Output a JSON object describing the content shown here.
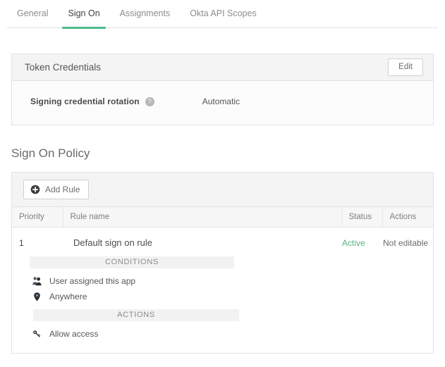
{
  "tabs": [
    {
      "label": "General",
      "active": false
    },
    {
      "label": "Sign On",
      "active": true
    },
    {
      "label": "Assignments",
      "active": false
    },
    {
      "label": "Okta API Scopes",
      "active": false
    }
  ],
  "token_credentials": {
    "title": "Token Credentials",
    "edit_label": "Edit",
    "help_glyph": "?",
    "field_label": "Signing credential rotation",
    "field_value": "Automatic"
  },
  "sign_on_policy": {
    "heading": "Sign On Policy",
    "add_rule_label": "Add Rule",
    "columns": [
      "Priority",
      "Rule name",
      "Status",
      "Actions"
    ],
    "rows": [
      {
        "priority": "1",
        "rule_name": "Default sign on rule",
        "status": "Active",
        "actions": "Not editable"
      }
    ],
    "conditions_band": "CONDITIONS",
    "conditions": [
      {
        "icon": "users-icon",
        "text": "User assigned this app"
      },
      {
        "icon": "location-pin-icon",
        "text": "Anywhere"
      }
    ],
    "actions_band": "ACTIONS",
    "actions": [
      {
        "icon": "key-icon",
        "text": "Allow access"
      }
    ]
  },
  "colors": {
    "accent_green": "#4cbb8c",
    "status_active": "#57b37f",
    "panel_border": "#e2e2e2",
    "panel_header_bg": "#f4f4f4",
    "band_bg": "#f2f2f2"
  }
}
